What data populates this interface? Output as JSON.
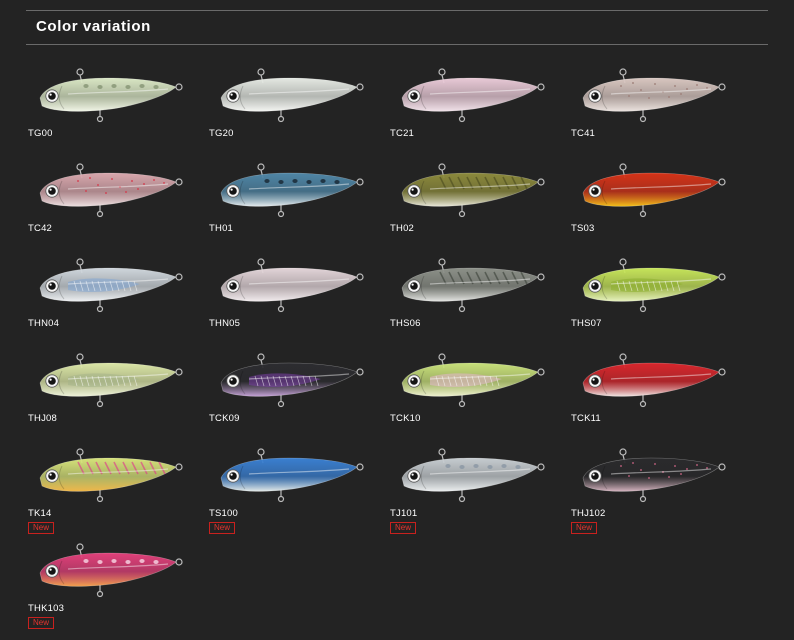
{
  "section": {
    "title": "Color variation"
  },
  "badge_label": "New",
  "items": [
    {
      "code": "TG00",
      "icon": "lure-image",
      "colors": {
        "back": "#d9e6c4",
        "belly": "#f2f6e8",
        "accent": "#8c9a7a"
      },
      "pattern": "spots",
      "is_new": false
    },
    {
      "code": "TG20",
      "icon": "lure-image",
      "colors": {
        "back": "#e4e8e2",
        "belly": "#f5f6f3",
        "accent": "#c9cec6"
      },
      "pattern": "plain",
      "is_new": false
    },
    {
      "code": "TC21",
      "icon": "lure-image",
      "colors": {
        "back": "#e8c9d6",
        "belly": "#f2e3ea",
        "accent": "#c8a6c0"
      },
      "pattern": "plain",
      "is_new": false
    },
    {
      "code": "TC41",
      "icon": "lure-image",
      "colors": {
        "back": "#d8c6c0",
        "belly": "#ece4e0",
        "accent": "#9d7f78"
      },
      "pattern": "speckle",
      "is_new": false
    },
    {
      "code": "TC42",
      "icon": "lure-image",
      "colors": {
        "back": "#d8a7ad",
        "belly": "#ece0e0",
        "accent": "#d43c4e"
      },
      "pattern": "speckle",
      "is_new": false
    },
    {
      "code": "TH01",
      "icon": "lure-image",
      "colors": {
        "back": "#4f86a6",
        "belly": "#e6ecee",
        "accent": "#1d2f3c"
      },
      "pattern": "spots",
      "is_new": false
    },
    {
      "code": "TH02",
      "icon": "lure-image",
      "colors": {
        "back": "#8c8a3c",
        "belly": "#e9e8da",
        "accent": "#4a4a1e"
      },
      "pattern": "stripes",
      "is_new": false
    },
    {
      "code": "TS03",
      "icon": "lure-image",
      "colors": {
        "back": "#d53318",
        "belly": "#f3c21b",
        "accent": "#8a1b0c"
      },
      "pattern": "plain",
      "is_new": false
    },
    {
      "code": "THN04",
      "icon": "lure-image",
      "colors": {
        "back": "#cfd6dc",
        "belly": "#eef0f2",
        "accent": "#7fa6d6"
      },
      "pattern": "holo",
      "is_new": false
    },
    {
      "code": "THN05",
      "icon": "lure-image",
      "colors": {
        "back": "#e2d4d8",
        "belly": "#f2ecee",
        "accent": "#c4b2b8"
      },
      "pattern": "plain",
      "is_new": false
    },
    {
      "code": "THS06",
      "icon": "lure-image",
      "colors": {
        "back": "#8c9088",
        "belly": "#e6e7e4",
        "accent": "#3a4038"
      },
      "pattern": "stripes",
      "is_new": false
    },
    {
      "code": "THS07",
      "icon": "lure-image",
      "colors": {
        "back": "#c6e45a",
        "belly": "#e8f2c2",
        "accent": "#8cae2e"
      },
      "pattern": "holo",
      "is_new": false
    },
    {
      "code": "THJ08",
      "icon": "lure-image",
      "colors": {
        "back": "#dbe6a6",
        "belly": "#eef2da",
        "accent": "#a6b48a"
      },
      "pattern": "holo",
      "is_new": false
    },
    {
      "code": "TCK09",
      "icon": "lure-image",
      "colors": {
        "back": "#2c2c30",
        "belly": "#c6a3d8",
        "accent": "#7a3ea8"
      },
      "pattern": "holo",
      "is_new": false
    },
    {
      "code": "TCK10",
      "icon": "lure-image",
      "colors": {
        "back": "#c8e07a",
        "belly": "#eef0d0",
        "accent": "#e6b6cf"
      },
      "pattern": "holo",
      "is_new": false
    },
    {
      "code": "TCK11",
      "icon": "lure-image",
      "colors": {
        "back": "#d8262c",
        "belly": "#efe6e4",
        "accent": "#8c1018"
      },
      "pattern": "plain",
      "is_new": false
    },
    {
      "code": "TK14",
      "icon": "lure-image",
      "colors": {
        "back": "#d6e27a",
        "belly": "#f0b648",
        "accent": "#e0348e"
      },
      "pattern": "stripes",
      "is_new": true
    },
    {
      "code": "TS100",
      "icon": "lure-image",
      "colors": {
        "back": "#3a7fd0",
        "belly": "#e6ece8",
        "accent": "#4fc46c"
      },
      "pattern": "plain",
      "is_new": true
    },
    {
      "code": "TJ101",
      "icon": "lure-image",
      "colors": {
        "back": "#c6ccd0",
        "belly": "#eceff0",
        "accent": "#8e9aa6"
      },
      "pattern": "spots",
      "is_new": true
    },
    {
      "code": "THJ102",
      "icon": "lure-image",
      "colors": {
        "back": "#2a2a2c",
        "belly": "#d8b6c2",
        "accent": "#c0607e"
      },
      "pattern": "speckle",
      "is_new": true
    },
    {
      "code": "THK103",
      "icon": "lure-image",
      "colors": {
        "back": "#e0407a",
        "belly": "#f2a24e",
        "accent": "#f2c6d8"
      },
      "pattern": "spots",
      "is_new": true
    }
  ]
}
